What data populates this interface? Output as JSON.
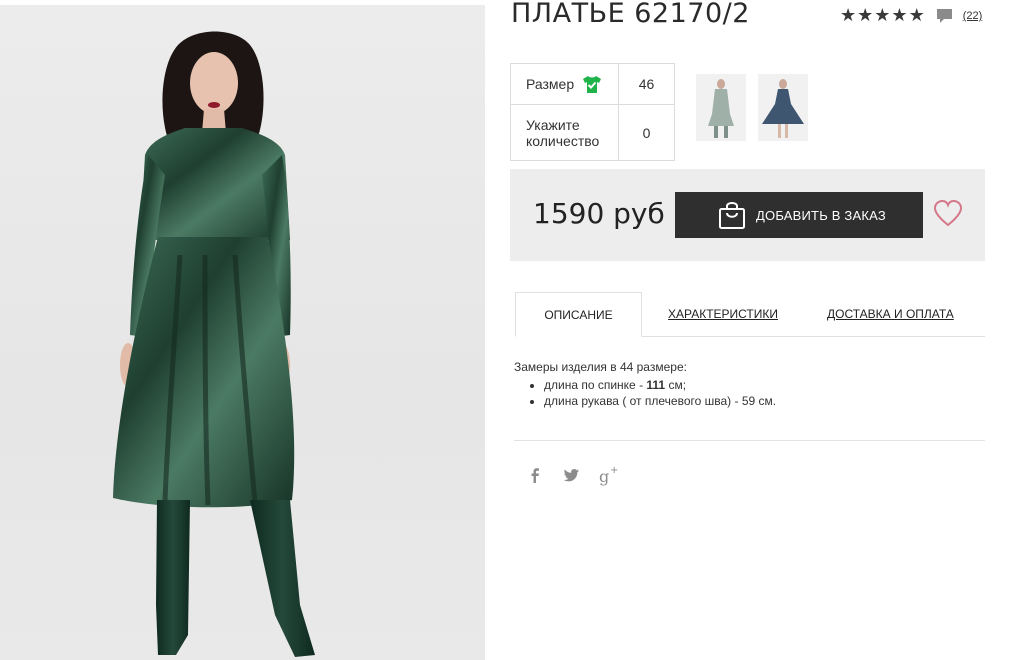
{
  "product": {
    "title": "ПЛАТЬЕ 62170/2",
    "rating": {
      "stars": 5,
      "reviews": "(22)"
    },
    "options": {
      "size_label": "Размер",
      "size_value": "46",
      "qty_label_line1": "Укажите",
      "qty_label_line2": "количество",
      "qty_value": "0"
    },
    "price": "1590 руб",
    "add_button": "ДОБАВИТЬ В ЗАКАЗ"
  },
  "tabs": [
    {
      "label": "ОПИСАНИЕ"
    },
    {
      "label": "ХАРАКТЕРИСТИКИ"
    },
    {
      "label": "ДОСТАВКА И ОПЛАТА"
    }
  ],
  "description": {
    "intro": "Замеры изделия в 44 размере:",
    "items": [
      {
        "prefix": "длина по спинке - ",
        "bold": "111",
        "suffix": " см;"
      },
      {
        "prefix": "длина рукава ( от плечевого шва) - 59 см.",
        "bold": "",
        "suffix": ""
      }
    ]
  },
  "colors": {
    "dress_green": "#2f5b48",
    "button_dark": "#2f2f2f",
    "check_green": "#1fb34a",
    "heart_pink": "#d5768a"
  },
  "icons": [
    "star-icon",
    "comment-icon",
    "tshirt-check-icon",
    "shopping-bag-icon",
    "heart-icon",
    "facebook-icon",
    "twitter-icon",
    "google-plus-icon"
  ]
}
